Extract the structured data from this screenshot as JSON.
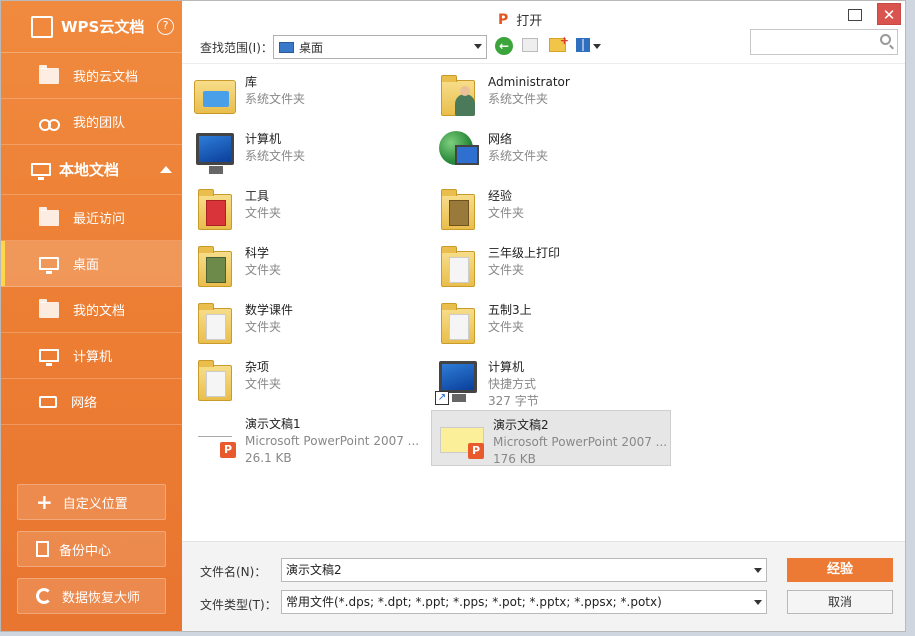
{
  "sidebar": {
    "brand": "WPS云文档",
    "help": "?",
    "cloud_items": [
      {
        "label": "我的云文档"
      },
      {
        "label": "我的团队"
      }
    ],
    "local_section": "本地文档",
    "local_items": [
      {
        "label": "最近访问"
      },
      {
        "label": "桌面"
      },
      {
        "label": "我的文档"
      },
      {
        "label": "计算机"
      },
      {
        "label": "网络"
      }
    ],
    "buttons": [
      {
        "label": "自定义位置"
      },
      {
        "label": "备份中心"
      },
      {
        "label": "数据恢复大师"
      }
    ]
  },
  "dialog": {
    "title": "打开",
    "close": "✕",
    "lookin_label": "查找范围(I)：",
    "lookin_value": "桌面",
    "search_placeholder": ""
  },
  "files": [
    {
      "name": "库",
      "sub": "系统文件夹",
      "sub2": ""
    },
    {
      "name": "Administrator",
      "sub": "系统文件夹",
      "sub2": ""
    },
    {
      "name": "计算机",
      "sub": "系统文件夹",
      "sub2": ""
    },
    {
      "name": "网络",
      "sub": "系统文件夹",
      "sub2": ""
    },
    {
      "name": "工具",
      "sub": "文件夹",
      "sub2": ""
    },
    {
      "name": "经验",
      "sub": "文件夹",
      "sub2": ""
    },
    {
      "name": "科学",
      "sub": "文件夹",
      "sub2": ""
    },
    {
      "name": "三年级上打印",
      "sub": "文件夹",
      "sub2": ""
    },
    {
      "name": "数学课件",
      "sub": "文件夹",
      "sub2": ""
    },
    {
      "name": "五制3上",
      "sub": "文件夹",
      "sub2": ""
    },
    {
      "name": "杂项",
      "sub": "文件夹",
      "sub2": ""
    },
    {
      "name": "计算机",
      "sub": "快捷方式",
      "sub2": "327 字节"
    },
    {
      "name": "演示文稿1",
      "sub": "Microsoft PowerPoint 2007 ...",
      "sub2": "26.1 KB"
    },
    {
      "name": "演示文稿2",
      "sub": "Microsoft PowerPoint 2007 ...",
      "sub2": "176 KB"
    }
  ],
  "bottom": {
    "filename_label": "文件名(N)：",
    "filename_value": "演示文稿2",
    "filetype_label": "文件类型(T)：",
    "filetype_value": "常用文件(*.dps; *.dpt; *.ppt; *.pps; *.pot; *.pptx; *.ppsx; *.potx)",
    "open_label": "经验",
    "cancel_label": "取消"
  },
  "colors": {
    "accent": "#ec7d33",
    "close": "#d9534f"
  }
}
